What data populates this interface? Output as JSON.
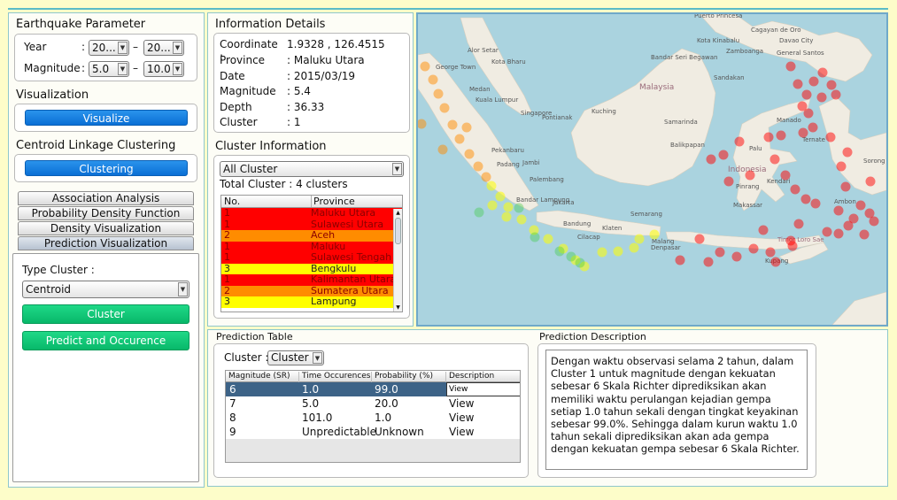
{
  "left": {
    "param_title": "Earthquake Parameter",
    "year_label": "Year",
    "year_from": "20...",
    "year_to": "20...",
    "mag_label": "Magnitude",
    "mag_from": "5.0",
    "mag_to": "10.0",
    "colon": ":",
    "dash": "–",
    "viz_title": "Visualization",
    "viz_button": "Visualize",
    "cl_title": "Centroid Linkage Clustering",
    "cl_button": "Clustering",
    "tabs": [
      "Association Analysis",
      "Probability Density Function",
      "Density Visualization",
      "Prediction Visualization"
    ],
    "type_cluster_label": "Type Cluster :",
    "type_cluster_value": "Centroid",
    "cluster_button": "Cluster",
    "predict_button": "Predict and Occurence"
  },
  "info": {
    "title": "Information Details",
    "rows": [
      {
        "k": "Coordinate :",
        "v": "1.9328 , 126.4515"
      },
      {
        "k": "Province",
        "v": ":   Maluku Utara"
      },
      {
        "k": "Date",
        "v": ":   2015/03/19"
      },
      {
        "k": "Magnitude",
        "v": ":   5.4"
      },
      {
        "k": "Depth",
        "v": ":   36.33"
      },
      {
        "k": "Cluster",
        "v": ":   1"
      }
    ]
  },
  "cluster_info": {
    "title": "Cluster Information",
    "filter": "All Cluster",
    "total": "Total Cluster : 4 clusters",
    "col_no": "No.",
    "col_province": "Province",
    "rows": [
      {
        "no": "1",
        "province": "Maluku Utara",
        "color": "#ff0000"
      },
      {
        "no": "1",
        "province": "Sulawesi Utara",
        "color": "#ff0000"
      },
      {
        "no": "2",
        "province": "Aceh",
        "color": "#ff8c00"
      },
      {
        "no": "1",
        "province": "Maluku",
        "color": "#ff0000"
      },
      {
        "no": "1",
        "province": "Sulawesi Tengah",
        "color": "#ff0000"
      },
      {
        "no": "3",
        "province": "Bengkulu",
        "color": "#ffff00"
      },
      {
        "no": "1",
        "province": "Kalimantan Utara",
        "color": "#ff0000"
      },
      {
        "no": "2",
        "province": "Sumatera Utara",
        "color": "#ff8c00"
      },
      {
        "no": "3",
        "province": "Lampung",
        "color": "#ffff00"
      }
    ]
  },
  "map": {
    "labels": [
      "Puerto Princesa",
      "Cagayan de Oro",
      "Davao City",
      "General Santos",
      "Zamboanga",
      "Bandar Seri Begawan",
      "Malaysia",
      "Kota Kinabalu",
      "Sandakan",
      "Kuching",
      "Pontianak",
      "Samarinda",
      "Balikpapan",
      "Palu",
      "Manado",
      "Kuala Lumpur",
      "Singapore",
      "Alor Setar",
      "Kota Bharu",
      "George Town",
      "Medan",
      "Pekanbaru",
      "Padang",
      "Jambi",
      "Palembang",
      "Bandar Lampung",
      "Jakarta",
      "Bandung",
      "Cilacap",
      "Semarang",
      "Klaten",
      "Malang",
      "Denpasar",
      "Makassar",
      "Pinrang",
      "Indonesia",
      "Kendari",
      "Kupang",
      "Timor Loro Sae",
      "Ambon",
      "Sorong",
      "Ternate"
    ],
    "points_red": [
      [
        893,
        75
      ],
      [
        901,
        95
      ],
      [
        911,
        107
      ],
      [
        919,
        92
      ],
      [
        928,
        110
      ],
      [
        906,
        120
      ],
      [
        913,
        128
      ],
      [
        918,
        144
      ],
      [
        907,
        150
      ],
      [
        882,
        153
      ],
      [
        868,
        155
      ],
      [
        835,
        160
      ],
      [
        817,
        175
      ],
      [
        875,
        180
      ],
      [
        887,
        198
      ],
      [
        898,
        214
      ],
      [
        910,
        225
      ],
      [
        921,
        230
      ],
      [
        947,
        238
      ],
      [
        964,
        247
      ],
      [
        958,
        255
      ],
      [
        972,
        232
      ],
      [
        982,
        241
      ],
      [
        987,
        250
      ],
      [
        976,
        265
      ],
      [
        947,
        264
      ],
      [
        934,
        262
      ],
      [
        902,
        253
      ],
      [
        955,
        211
      ],
      [
        983,
        205
      ],
      [
        893,
        272
      ],
      [
        870,
        285
      ],
      [
        832,
        290
      ],
      [
        800,
        296
      ],
      [
        768,
        294
      ],
      [
        790,
        270
      ],
      [
        813,
        285
      ],
      [
        862,
        260
      ],
      [
        876,
        296
      ],
      [
        895,
        278
      ],
      [
        851,
        281
      ],
      [
        803,
        180
      ],
      [
        823,
        205
      ],
      [
        847,
        198
      ],
      [
        950,
        188
      ],
      [
        938,
        155
      ],
      [
        957,
        172
      ],
      [
        929,
        82
      ],
      [
        939,
        96
      ],
      [
        944,
        107
      ]
    ],
    "points_orange": [
      [
        480,
        75
      ],
      [
        489,
        90
      ],
      [
        495,
        106
      ],
      [
        502,
        122
      ],
      [
        511,
        141
      ],
      [
        519,
        157
      ],
      [
        530,
        174
      ],
      [
        540,
        188
      ],
      [
        549,
        200
      ],
      [
        476,
        140
      ],
      [
        527,
        144
      ],
      [
        500,
        169
      ]
    ],
    "points_yellow": [
      [
        555,
        210
      ],
      [
        565,
        222
      ],
      [
        574,
        234
      ],
      [
        589,
        248
      ],
      [
        603,
        260
      ],
      [
        619,
        270
      ],
      [
        636,
        281
      ],
      [
        650,
        294
      ],
      [
        660,
        301
      ],
      [
        680,
        285
      ],
      [
        698,
        284
      ],
      [
        716,
        280
      ],
      [
        722,
        270
      ],
      [
        739,
        265
      ],
      [
        556,
        232
      ],
      [
        572,
        245
      ]
    ],
    "points_green": [
      [
        541,
        240
      ],
      [
        586,
        235
      ],
      [
        604,
        268
      ],
      [
        632,
        284
      ],
      [
        645,
        290
      ],
      [
        655,
        297
      ]
    ]
  },
  "prediction": {
    "table_title": "Prediction Table",
    "cluster_label": "Cluster :",
    "cluster_value": "Cluster 1",
    "headers": [
      "Magnitude (SR)",
      "Time Occurences (...",
      "Probability (%)",
      "Description"
    ],
    "rows": [
      {
        "mag": "6",
        "time": "1.0",
        "prob": "99.0",
        "desc": "View"
      },
      {
        "mag": "7",
        "time": "5.0",
        "prob": "20.0",
        "desc": "View"
      },
      {
        "mag": "8",
        "time": "101.0",
        "prob": "1.0",
        "desc": "View"
      },
      {
        "mag": "9",
        "time": "Unpredictable",
        "prob": "Unknown",
        "desc": "View"
      }
    ],
    "desc_title": "Prediction Description",
    "desc_text": "Dengan waktu observasi selama 2 tahun, dalam Cluster 1 untuk magnitude dengan kekuatan sebesar 6 Skala Richter diprediksikan akan memiliki waktu perulangan kejadian gempa setiap 1.0 tahun sekali dengan tingkat keyakinan sebesar 99.0%. Sehingga dalam kurun waktu 1.0 tahun sekali diprediksikan akan ada gempa dengan kekuatan gempa sebesar 6 Skala Richter."
  },
  "colors": {
    "cluster1": "#ff0000",
    "cluster2": "#ff8c00",
    "cluster3": "#ffff00",
    "cluster4": "#33cc33",
    "accent_blue": "#0a6fd5",
    "accent_green": "#08b86a",
    "background": "#fdfdc9"
  }
}
